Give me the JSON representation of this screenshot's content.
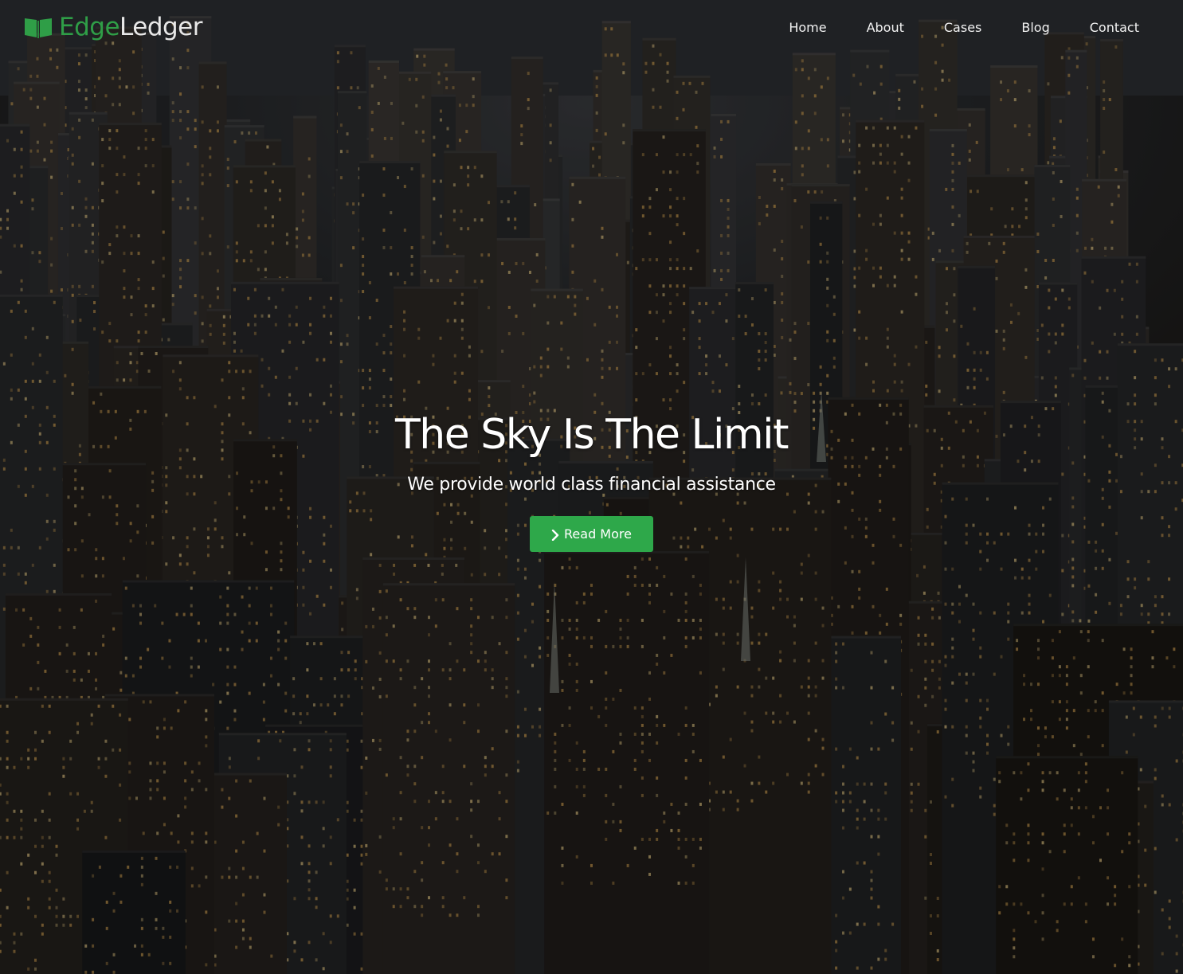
{
  "brand": {
    "name_part_1": "Edge",
    "name_part_2": "Ledger",
    "icon": "open-book-icon",
    "accent_color": "#2f9e47"
  },
  "nav": {
    "items": [
      {
        "label": "Home"
      },
      {
        "label": "About"
      },
      {
        "label": "Cases"
      },
      {
        "label": "Blog"
      },
      {
        "label": "Contact"
      }
    ]
  },
  "hero": {
    "title": "The Sky Is The Limit",
    "subtitle": "We provide world class financial assistance",
    "cta": {
      "label": "Read More",
      "icon": "chevron-right-icon",
      "color": "#2ea84a"
    },
    "background": "night city skyline aerial photo"
  }
}
